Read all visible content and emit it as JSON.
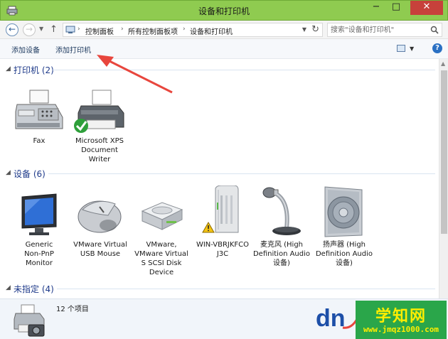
{
  "window": {
    "title": "设备和打印机",
    "minimize_glyph": "−",
    "maximize_glyph": "□",
    "close_glyph": "✕"
  },
  "address": {
    "back_glyph": "←",
    "forward_glyph": "→",
    "recent_glyph": "▼",
    "up_glyph": "↑",
    "breadcrumb": [
      "控制面板",
      "所有控制面板项",
      "设备和打印机"
    ],
    "separator": "›",
    "refresh_glyph": "↻",
    "search_placeholder": "搜索\"设备和打印机\""
  },
  "toolbar": {
    "add_device": "添加设备",
    "add_printer": "添加打印机",
    "view_dropdown_glyph": "▼",
    "help_glyph": "?"
  },
  "groups": {
    "printers": {
      "title": "打印机 (2)",
      "chevron": "◢"
    },
    "devices": {
      "title": "设备 (6)",
      "chevron": "◢"
    },
    "unspecified": {
      "title": "未指定 (4)",
      "chevron": "◢"
    }
  },
  "printers": [
    {
      "label": "Fax",
      "icon": "fax-icon"
    },
    {
      "label": "Microsoft XPS\nDocument\nWriter",
      "icon": "printer-default-icon"
    }
  ],
  "devices": [
    {
      "label": "Generic\nNon-PnP\nMonitor",
      "icon": "monitor-icon"
    },
    {
      "label": "VMware Virtual\nUSB Mouse",
      "icon": "mouse-icon"
    },
    {
      "label": "VMware,\nVMware Virtual\nS SCSI Disk\nDevice",
      "icon": "disk-drive-icon"
    },
    {
      "label": "WIN-VBRJKFCO\nJ3C",
      "icon": "computer-warning-icon"
    },
    {
      "label": "麦克风 (High\nDefinition Audio\n设备)",
      "icon": "microphone-icon"
    },
    {
      "label": "扬声器 (High\nDefinition Audio\n设备)",
      "icon": "speaker-icon"
    }
  ],
  "status": {
    "item_count": "12 个项目",
    "icon": "printer-camera-icon"
  },
  "watermark": {
    "logo_text": "dn",
    "title": "学知网",
    "url": "www.jmqz1000.com"
  },
  "colors": {
    "titlebar": "#8fcb50",
    "close_button": "#c7413b",
    "group_title": "#1e3a8a",
    "annotation_arrow": "#e8463d",
    "watermark_bg": "#2aa64a",
    "watermark_text": "#ffee00"
  }
}
